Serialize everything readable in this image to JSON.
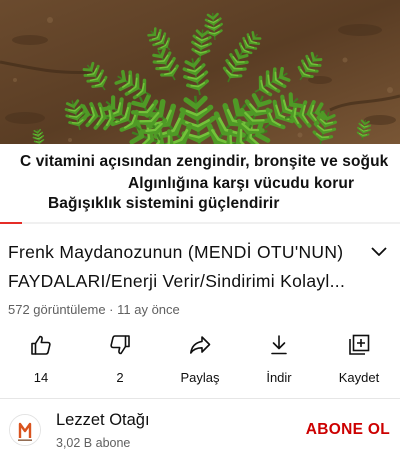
{
  "video": {
    "caption_lines": [
      "C vitamini açısından zengindir, bronşite ve soğuk",
      "Algınlığına karşı vücudu korur",
      "Bağışıklık sistemini güçlendirir"
    ],
    "progress_fraction": 0.055,
    "progress_color": "#e52d27"
  },
  "title": {
    "line1": "Frenk Maydanozunun (MENDİ OTU'NUN)",
    "line2": "FAYDALARI/Enerji Verir/Sindirimi Kolayl...",
    "expand_icon": "chevron-down-icon"
  },
  "meta": {
    "text": "572 görüntüleme · 11 ay önce"
  },
  "actions": {
    "like": {
      "label": "14",
      "icon": "thumbs-up-icon"
    },
    "dislike": {
      "label": "2",
      "icon": "thumbs-down-icon"
    },
    "share": {
      "label": "Paylaş",
      "icon": "share-icon"
    },
    "download": {
      "label": "İndir",
      "icon": "download-icon"
    },
    "save": {
      "label": "Kaydet",
      "icon": "add-to-playlist-icon"
    }
  },
  "channel": {
    "name": "Lezzet Otağı",
    "subscribers": "3,02 B abone",
    "subscribe_label": "ABONE OL",
    "subscribe_color": "#cc0000",
    "avatar_icon": "channel-logo-icon"
  }
}
